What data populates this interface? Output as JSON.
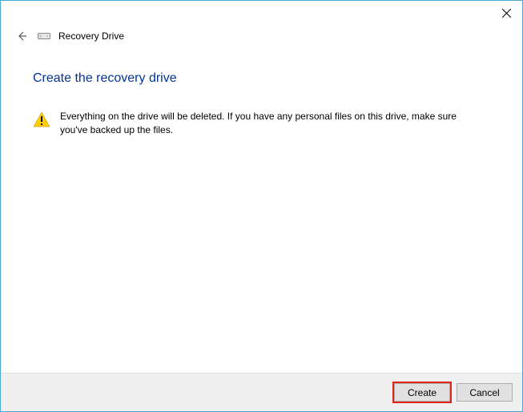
{
  "titlebar": {
    "close_label": "Close"
  },
  "nav": {
    "back_label": "Back",
    "window_title": "Recovery Drive"
  },
  "content": {
    "heading": "Create the recovery drive",
    "warning_text": "Everything on the drive will be deleted. If you have any personal files on this drive, make sure you've backed up the files."
  },
  "footer": {
    "create_label": "Create",
    "cancel_label": "Cancel"
  }
}
